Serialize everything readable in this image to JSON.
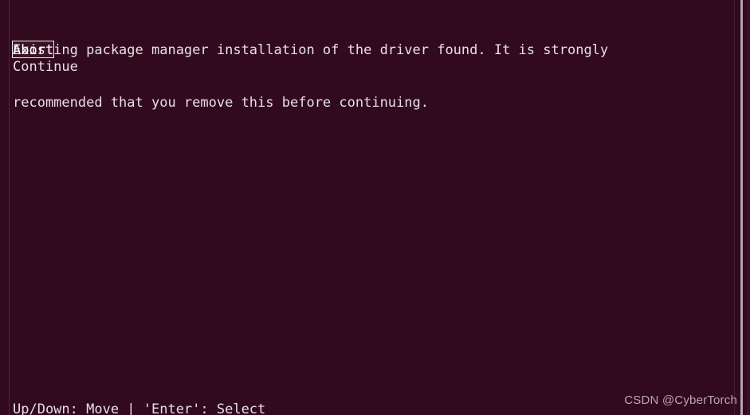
{
  "window": {
    "title": "Existing package manager installation of the driver found.",
    "background_color": "#320a1d",
    "text_color": "#e8dfe6",
    "selection_border_color": "#f2eaf0"
  },
  "message": {
    "line1": "Existing package manager installation of the driver found. It is strongly",
    "line2": "recommended that you remove this before continuing."
  },
  "menu": {
    "items": [
      {
        "label": "Abort",
        "selected": true
      },
      {
        "label": "Continue",
        "selected": false
      }
    ]
  },
  "footer": {
    "hint": "Up/Down: Move | 'Enter': Select"
  },
  "watermark": {
    "text": "CSDN @CyberTorch"
  }
}
